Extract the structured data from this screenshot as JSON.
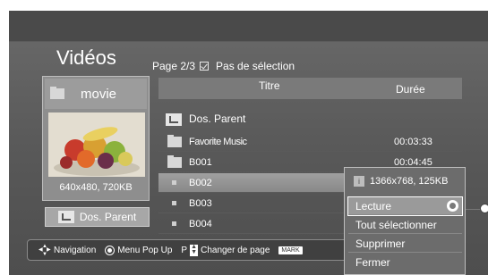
{
  "screen": {
    "title": "Vidéos",
    "page_info": "Page 2/3",
    "selection_status": "Pas de sélection"
  },
  "preview": {
    "folder_name": "movie",
    "thumb_info": "640x480, 720KB",
    "parent_button": "Dos. Parent"
  },
  "table": {
    "header_title": "Titre",
    "header_duration": "Durée",
    "rows": [
      {
        "name": "Dos. Parent",
        "duration": "",
        "kind": "parent"
      },
      {
        "name": "Favorite Music",
        "duration": "00:03:33",
        "kind": "folder"
      },
      {
        "name": "B001",
        "duration": "00:04:45",
        "kind": "folder"
      },
      {
        "name": "B002",
        "duration": "",
        "kind": "file",
        "selected": true
      },
      {
        "name": "B003",
        "duration": "",
        "kind": "file"
      },
      {
        "name": "B004",
        "duration": "",
        "kind": "file"
      }
    ]
  },
  "popup": {
    "info": "1366x768, 125KB",
    "items": [
      "Lecture",
      "Tout sélectionner",
      "Supprimer",
      "Fermer"
    ],
    "active_index": 0
  },
  "bottom_bar": {
    "navigation": "Navigation",
    "menu": "Menu Pop Up",
    "page_key": "P",
    "change_page": "Changer de page",
    "mark_key": "MARK"
  },
  "icons": [
    "folder-icon",
    "parent-folder-icon",
    "info-icon",
    "radio-icon",
    "nav-arrows-icon",
    "ok-button-icon",
    "updown-icon"
  ]
}
